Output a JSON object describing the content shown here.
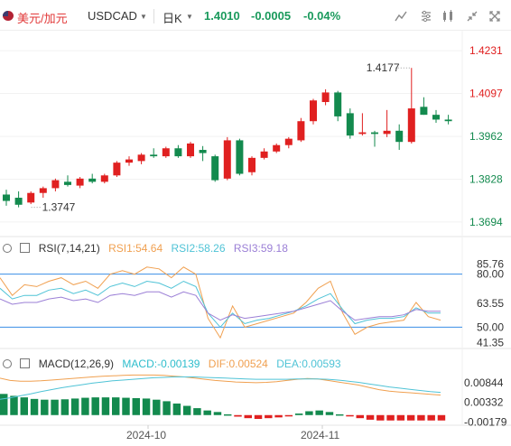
{
  "header": {
    "symbol_cn": "美元/加元",
    "symbol_code": "USDCAD",
    "period": "日K",
    "last_price": "1.4010",
    "change": "-0.0005",
    "change_pct": "-0.04%",
    "quote_color": "#1a9a5c"
  },
  "toolbar_icons": [
    "chart-type-icon",
    "indicator-icon",
    "drawing-icon",
    "shrink-icon",
    "fullscreen-icon"
  ],
  "colors": {
    "up": "#e02020",
    "down": "#138a4e",
    "rsi1": "#f0a050",
    "rsi2": "#4fc3d6",
    "rsi3": "#9b7fd6",
    "macd": "#2dbdcc",
    "dif": "#f0a050",
    "dea": "#4fc3d6"
  },
  "chart_data": [
    {
      "type": "candlestick",
      "y_ticks": [
        "1.4231",
        "1.4097",
        "1.3962",
        "1.3828",
        "1.3694"
      ],
      "ylim": [
        1.3654,
        1.4271
      ],
      "high_label": "1.4177",
      "low_label": "1.3747",
      "x_ticks": [
        "2024-10",
        "2024-11"
      ],
      "candles": [
        [
          1.378,
          1.3795,
          1.3745,
          1.376
        ],
        [
          1.377,
          1.379,
          1.374,
          1.3748
        ],
        [
          1.3755,
          1.379,
          1.375,
          1.3785
        ],
        [
          1.3785,
          1.3805,
          1.377,
          1.38
        ],
        [
          1.38,
          1.383,
          1.379,
          1.3825
        ],
        [
          1.382,
          1.384,
          1.3805,
          1.381
        ],
        [
          1.3808,
          1.3835,
          1.38,
          1.383
        ],
        [
          1.383,
          1.3845,
          1.3815,
          1.382
        ],
        [
          1.382,
          1.3845,
          1.3815,
          1.384
        ],
        [
          1.384,
          1.3885,
          1.3835,
          1.388
        ],
        [
          1.388,
          1.39,
          1.387,
          1.389
        ],
        [
          1.3885,
          1.391,
          1.3875,
          1.3905
        ],
        [
          1.3905,
          1.3925,
          1.3895,
          1.39
        ],
        [
          1.39,
          1.393,
          1.3895,
          1.3925
        ],
        [
          1.3925,
          1.3935,
          1.3895,
          1.39
        ],
        [
          1.39,
          1.3945,
          1.3895,
          1.394
        ],
        [
          1.392,
          1.3932,
          1.3885,
          1.391
        ],
        [
          1.39,
          1.3905,
          1.382,
          1.3825
        ],
        [
          1.383,
          1.396,
          1.3825,
          1.395
        ],
        [
          1.395,
          1.3955,
          1.384,
          1.3845
        ],
        [
          1.385,
          1.39,
          1.384,
          1.3895
        ],
        [
          1.3895,
          1.3925,
          1.389,
          1.3915
        ],
        [
          1.3915,
          1.394,
          1.391,
          1.3935
        ],
        [
          1.3935,
          1.396,
          1.3925,
          1.3955
        ],
        [
          1.395,
          1.402,
          1.3945,
          1.401
        ],
        [
          1.401,
          1.408,
          1.4,
          1.4075
        ],
        [
          1.407,
          1.411,
          1.406,
          1.41
        ],
        [
          1.41,
          1.4105,
          1.401,
          1.4025
        ],
        [
          1.4035,
          1.405,
          1.3955,
          1.3965
        ],
        [
          1.397,
          1.4035,
          1.3965,
          1.3975
        ],
        [
          1.3975,
          1.398,
          1.393,
          1.397
        ],
        [
          1.397,
          1.4045,
          1.396,
          1.398
        ],
        [
          1.398,
          1.4,
          1.392,
          1.3945
        ],
        [
          1.3945,
          1.4177,
          1.394,
          1.405
        ],
        [
          1.4055,
          1.4085,
          1.403,
          1.403
        ],
        [
          1.403,
          1.4045,
          1.4005,
          1.4015
        ],
        [
          1.4015,
          1.403,
          1.4,
          1.401
        ]
      ]
    },
    {
      "type": "line",
      "name": "RSI(7,14,21)",
      "legend": {
        "rsi1": "RSI1:54.64",
        "rsi2": "RSI2:58.26",
        "rsi3": "RSI3:59.18"
      },
      "y_ticks": [
        "85.76",
        "80.00",
        "63.55",
        "50.00",
        "41.35"
      ],
      "ylim": [
        40,
        88
      ],
      "ref_lines": [
        80,
        50
      ],
      "series": [
        {
          "name": "RSI1",
          "values": [
            78,
            68,
            74,
            73,
            76,
            78,
            74,
            76,
            72,
            80,
            82,
            80,
            84,
            83,
            78,
            84,
            80,
            55,
            44,
            62,
            50,
            52,
            54,
            56,
            58,
            64,
            72,
            76,
            58,
            46,
            50,
            52,
            53,
            54,
            64,
            56,
            54
          ]
        },
        {
          "name": "RSI2",
          "values": [
            72,
            66,
            68,
            68,
            71,
            72,
            69,
            71,
            68,
            73,
            75,
            73,
            76,
            75,
            72,
            76,
            73,
            58,
            50,
            58,
            52,
            54,
            55,
            57,
            59,
            62,
            66,
            69,
            60,
            52,
            54,
            55,
            55,
            56,
            61,
            58,
            58
          ]
        },
        {
          "name": "RSI3",
          "values": [
            66,
            63,
            64,
            64,
            66,
            67,
            65,
            66,
            64,
            68,
            69,
            68,
            70,
            70,
            67,
            70,
            68,
            58,
            54,
            57,
            55,
            56,
            57,
            58,
            59,
            61,
            63,
            65,
            59,
            54,
            55,
            56,
            56,
            57,
            60,
            59,
            59
          ]
        }
      ]
    },
    {
      "type": "bar",
      "name": "MACD(12,26,9)",
      "legend": {
        "macd": "MACD:-0.00139",
        "dif": "DIF:0.00524",
        "dea": "DEA:0.00593"
      },
      "y_ticks": [
        "0.00844",
        "0.00332",
        "-0.00179"
      ],
      "ylim": [
        -0.0024,
        0.0112
      ],
      "macd_hist": [
        0.0055,
        0.005,
        0.0046,
        0.0042,
        0.004,
        0.004,
        0.0041,
        0.0043,
        0.0045,
        0.0046,
        0.0046,
        0.0046,
        0.0045,
        0.0044,
        0.0043,
        0.004,
        0.0036,
        0.003,
        0.0024,
        0.0018,
        0.0012,
        0.0008,
        0.0002,
        -0.0004,
        -0.0008,
        -0.001,
        -0.0008,
        -0.0006,
        -0.0002,
        0.0004,
        0.001,
        0.0012,
        0.0008,
        0.0002,
        -0.0002,
        -0.0008,
        -0.0012,
        -0.0014,
        -0.0014,
        -0.0014,
        -0.0014,
        -0.0014,
        -0.0014,
        -0.0014
      ],
      "dif": [
        0.0096,
        0.009,
        0.0088,
        0.0088,
        0.0089,
        0.0091,
        0.0093,
        0.0095,
        0.0097,
        0.0099,
        0.0101,
        0.0102,
        0.0103,
        0.0104,
        0.0104,
        0.0104,
        0.0103,
        0.0101,
        0.0099,
        0.0096,
        0.0093,
        0.009,
        0.0088,
        0.0086,
        0.0085,
        0.0084,
        0.0085,
        0.0087,
        0.009,
        0.0093,
        0.0095,
        0.0094,
        0.009,
        0.0086,
        0.0082,
        0.0078,
        0.0072,
        0.0066,
        0.0062,
        0.006,
        0.0058,
        0.0056,
        0.0054,
        0.0052
      ],
      "dea": [
        0.0041,
        0.0045,
        0.005,
        0.0055,
        0.0061,
        0.0066,
        0.0071,
        0.0075,
        0.0079,
        0.0083,
        0.0086,
        0.0089,
        0.0091,
        0.0093,
        0.0095,
        0.0097,
        0.0098,
        0.0099,
        0.0099,
        0.0099,
        0.0098,
        0.0097,
        0.0096,
        0.0095,
        0.0094,
        0.0093,
        0.0093,
        0.0093,
        0.0093,
        0.0094,
        0.0094,
        0.0094,
        0.0093,
        0.0091,
        0.0088,
        0.0085,
        0.0081,
        0.0077,
        0.0073,
        0.007,
        0.0067,
        0.0064,
        0.0061,
        0.0059
      ]
    }
  ]
}
